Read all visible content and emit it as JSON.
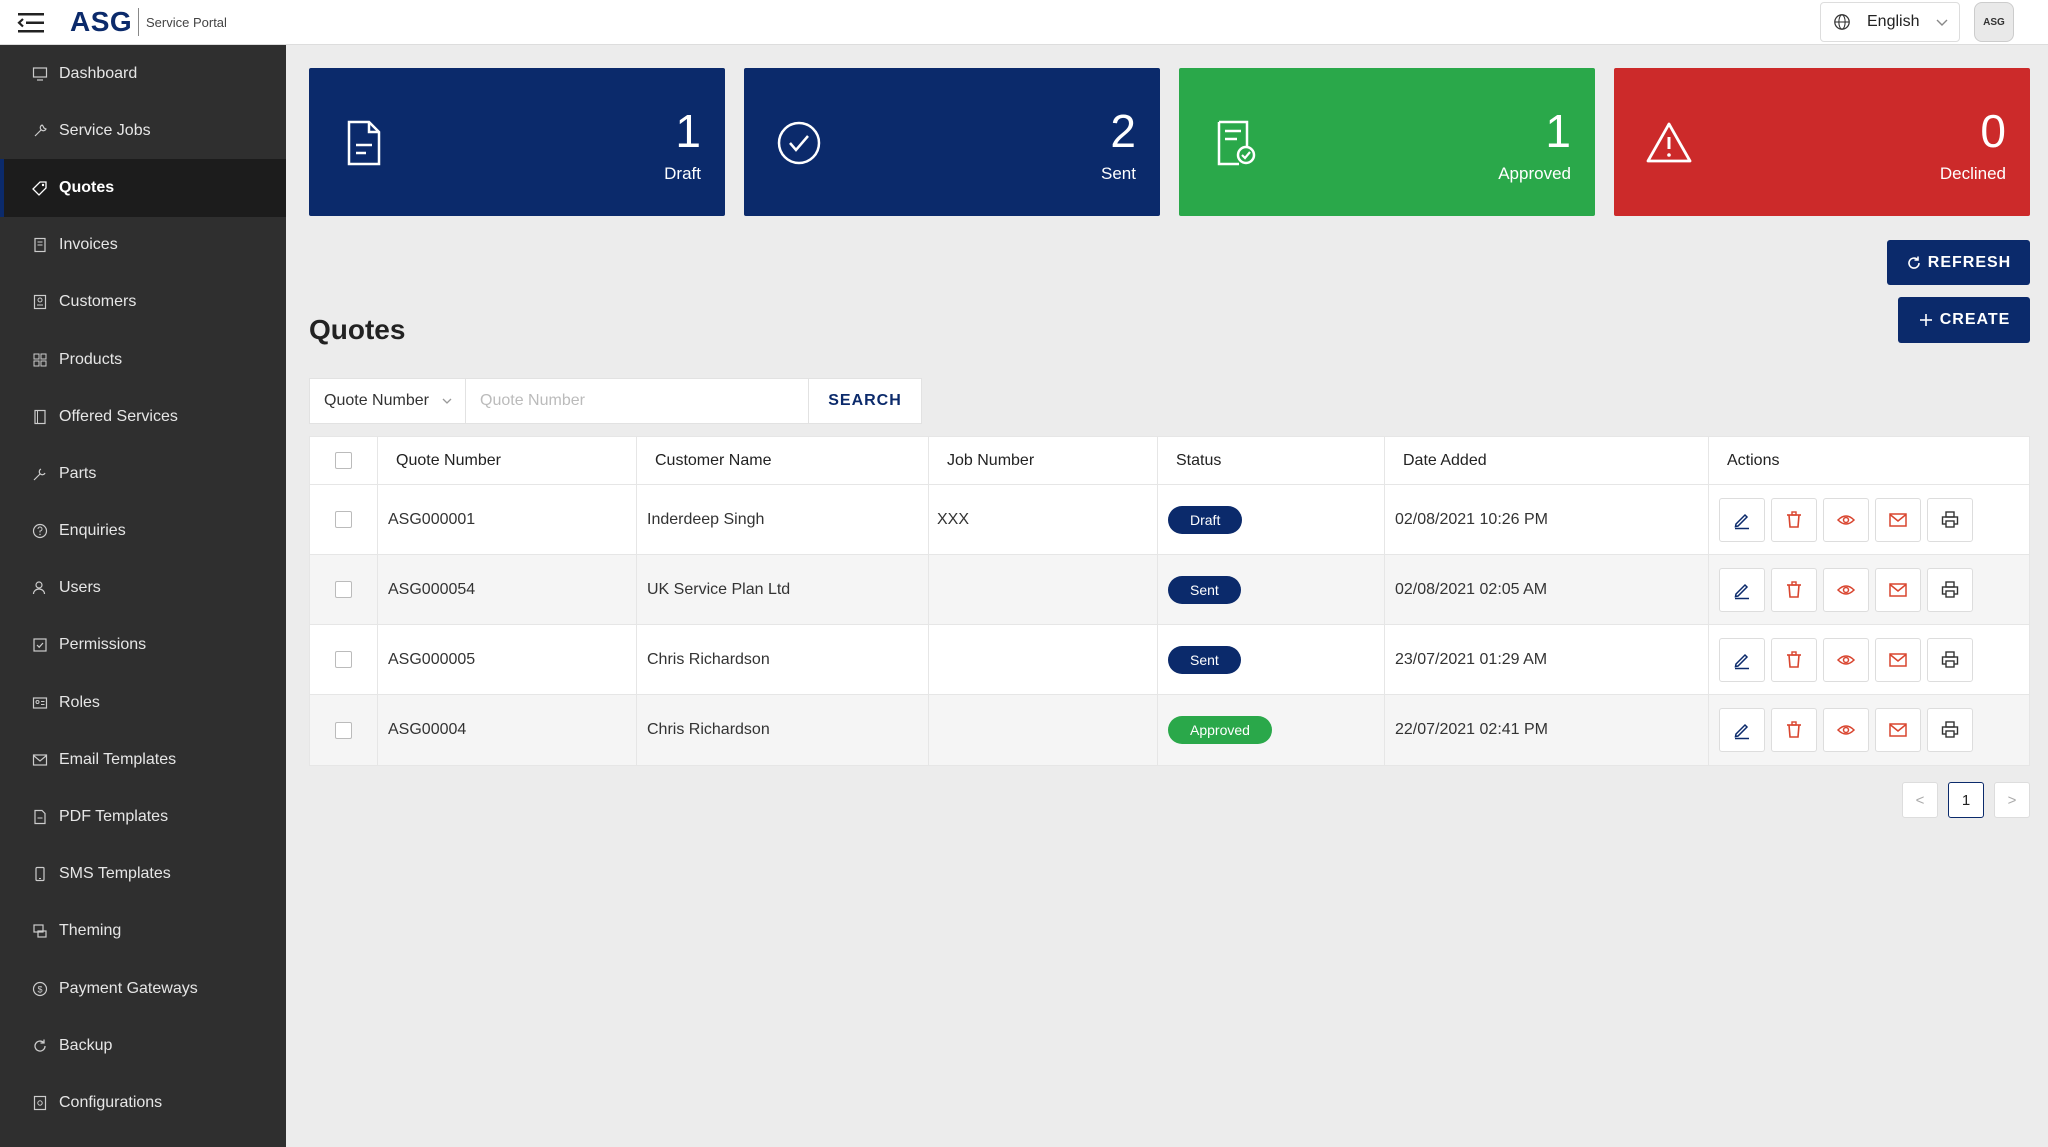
{
  "app": {
    "logo": "ASG",
    "subtitle": "Service Portal"
  },
  "header": {
    "language": "English",
    "avatar_text": "ASG"
  },
  "sidebar": {
    "items": [
      {
        "label": "Dashboard",
        "icon": "monitor-icon"
      },
      {
        "label": "Service Jobs",
        "icon": "wrench-icon"
      },
      {
        "label": "Quotes",
        "icon": "tag-icon",
        "active": true
      },
      {
        "label": "Invoices",
        "icon": "invoice-icon"
      },
      {
        "label": "Customers",
        "icon": "customers-icon"
      },
      {
        "label": "Products",
        "icon": "grid-icon"
      },
      {
        "label": "Offered Services",
        "icon": "book-icon"
      },
      {
        "label": "Parts",
        "icon": "tool-icon"
      },
      {
        "label": "Enquiries",
        "icon": "question-icon"
      },
      {
        "label": "Users",
        "icon": "user-icon"
      },
      {
        "label": "Permissions",
        "icon": "check-square-icon"
      },
      {
        "label": "Roles",
        "icon": "id-card-icon"
      },
      {
        "label": "Email Templates",
        "icon": "mail-icon"
      },
      {
        "label": "PDF Templates",
        "icon": "pdf-icon"
      },
      {
        "label": "SMS Templates",
        "icon": "phone-icon"
      },
      {
        "label": "Theming",
        "icon": "palette-icon"
      },
      {
        "label": "Payment Gateways",
        "icon": "dollar-icon"
      },
      {
        "label": "Backup",
        "icon": "refresh-icon"
      },
      {
        "label": "Configurations",
        "icon": "config-icon"
      }
    ]
  },
  "stats": [
    {
      "value": "1",
      "label": "Draft",
      "color": "#0b2a6b",
      "icon": "document-icon"
    },
    {
      "value": "2",
      "label": "Sent",
      "color": "#0b2a6b",
      "icon": "check-circle-icon"
    },
    {
      "value": "1",
      "label": "Approved",
      "color": "#2aa84a",
      "icon": "approved-doc-icon"
    },
    {
      "value": "0",
      "label": "Declined",
      "color": "#cc2a2a",
      "icon": "warning-icon"
    }
  ],
  "buttons": {
    "refresh": "REFRESH",
    "create": "CREATE"
  },
  "page": {
    "title": "Quotes"
  },
  "search": {
    "field": "Quote Number",
    "placeholder": "Quote Number",
    "button": "SEARCH"
  },
  "table": {
    "headers": [
      "Quote Number",
      "Customer Name",
      "Job Number",
      "Status",
      "Date Added",
      "Actions"
    ],
    "rows": [
      {
        "quote_number": "ASG000001",
        "customer": "Inderdeep Singh",
        "job_number": "XXX",
        "status": "Draft",
        "date_added": "02/08/2021 10:26 PM"
      },
      {
        "quote_number": "ASG000054",
        "customer": "UK Service Plan Ltd",
        "job_number": "",
        "status": "Sent",
        "date_added": "02/08/2021 02:05 AM"
      },
      {
        "quote_number": "ASG000005",
        "customer": "Chris Richardson",
        "job_number": "",
        "status": "Sent",
        "date_added": "23/07/2021 01:29 AM"
      },
      {
        "quote_number": "ASG00004",
        "customer": "Chris Richardson",
        "job_number": "",
        "status": "Approved",
        "date_added": "22/07/2021 02:41 PM"
      }
    ],
    "actions": [
      "edit-icon",
      "trash-icon",
      "eye-icon",
      "mail-icon",
      "printer-icon"
    ]
  },
  "pagination": {
    "current": "1",
    "prev": "<",
    "next": ">"
  },
  "colors": {
    "primary": "#0b2a6b",
    "success": "#2aa84a",
    "danger": "#cc2a2a",
    "sidebar": "#2f2f2f",
    "action_red": "#d9452f"
  }
}
